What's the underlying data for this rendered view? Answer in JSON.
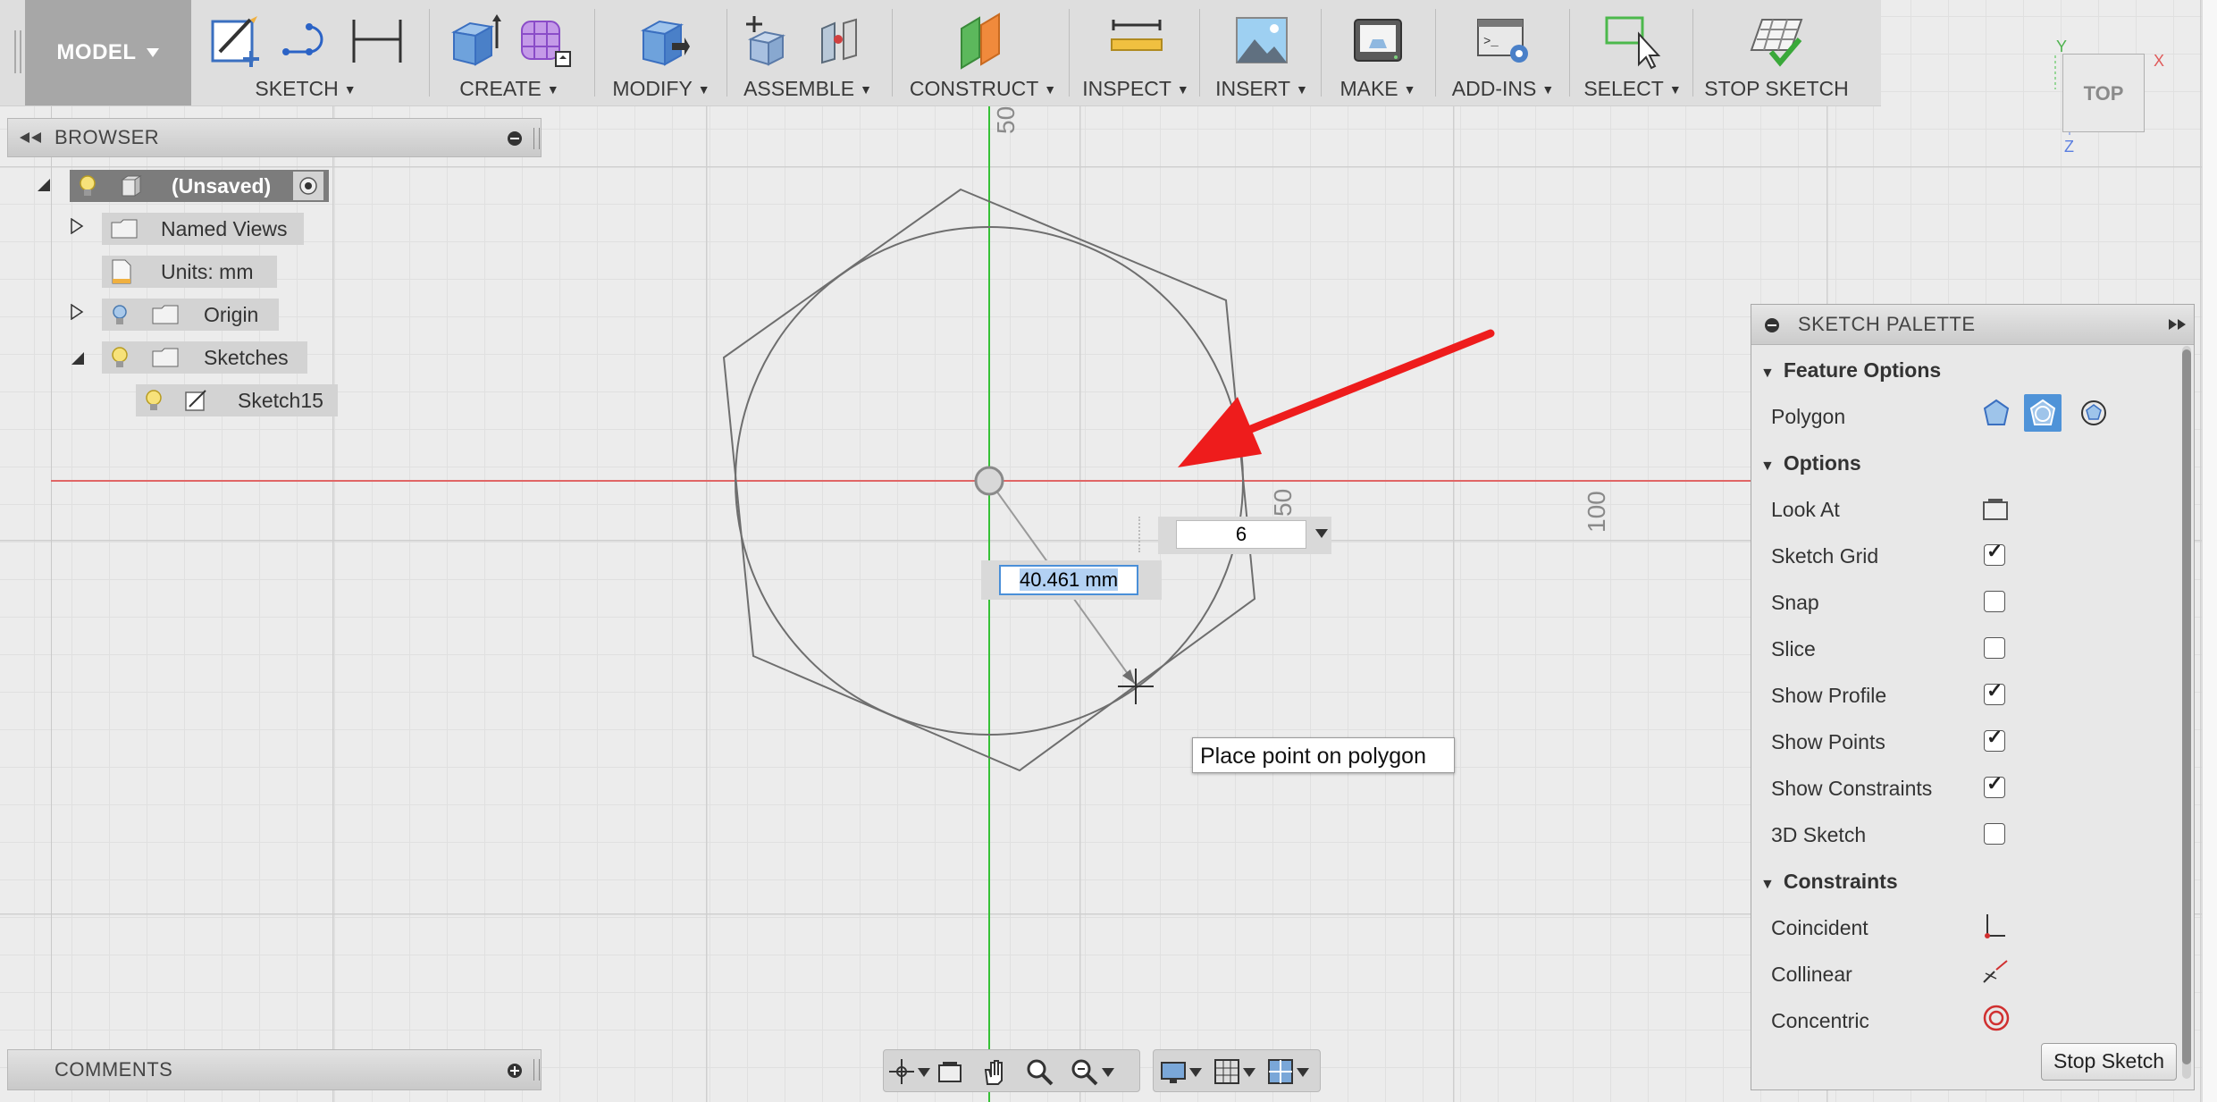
{
  "toolbar": {
    "model": "MODEL",
    "groups": {
      "sketch": "SKETCH",
      "create": "CREATE",
      "modify": "MODIFY",
      "assemble": "ASSEMBLE",
      "construct": "CONSTRUCT",
      "inspect": "INSPECT",
      "insert": "INSERT",
      "make": "MAKE",
      "addins": "ADD-INS",
      "select": "SELECT",
      "stop_sketch": "STOP SKETCH"
    }
  },
  "browser": {
    "title": "BROWSER",
    "items": {
      "root": "(Unsaved)",
      "named_views": "Named Views",
      "units": "Units: mm",
      "origin": "Origin",
      "sketches": "Sketches",
      "sketch15": "Sketch15"
    }
  },
  "comments": {
    "title": "COMMENTS"
  },
  "canvas": {
    "dim_labels": {
      "top": "50",
      "right": "50",
      "right_far": "100"
    },
    "radius_value": "40.461 mm",
    "sides_value": "6",
    "tooltip": "Place point on polygon",
    "axis_colors": {
      "x_axis": "#e06666",
      "y_axis": "#36c136"
    },
    "annotation_arrow_color": "#ee1c1c"
  },
  "viewcube": {
    "face": "TOP",
    "axes": {
      "x": "X",
      "y": "Y",
      "z": "Z"
    }
  },
  "palette": {
    "title": "SKETCH PALETTE",
    "sections": {
      "feature_options": "Feature Options",
      "options": "Options",
      "constraints": "Constraints"
    },
    "polygon": "Polygon",
    "options": {
      "look_at": "Look At",
      "sketch_grid": "Sketch Grid",
      "snap": "Snap",
      "slice": "Slice",
      "show_profile": "Show Profile",
      "show_points": "Show Points",
      "show_constraints": "Show Constraints",
      "sketch_3d": "3D Sketch"
    },
    "checked": {
      "sketch_grid": true,
      "snap": false,
      "slice": false,
      "show_profile": true,
      "show_points": true,
      "show_constraints": true,
      "sketch_3d": false
    },
    "constraints": {
      "coincident": "Coincident",
      "collinear": "Collinear",
      "concentric": "Concentric"
    },
    "stop_button": "Stop Sketch"
  }
}
